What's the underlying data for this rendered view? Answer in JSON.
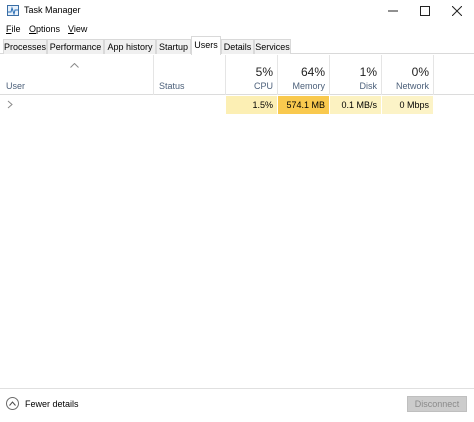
{
  "window": {
    "title": "Task Manager"
  },
  "menu": {
    "file": {
      "ul": "F",
      "rest": "ile"
    },
    "options": {
      "ul": "O",
      "rest": "ptions"
    },
    "view": {
      "ul": "V",
      "rest": "iew"
    }
  },
  "tabs": [
    "Processes",
    "Performance",
    "App history",
    "Startup",
    "Users",
    "Details",
    "Services"
  ],
  "active_tab": "Users",
  "columns": {
    "user": "User",
    "status": "Status",
    "cpu": {
      "pct": "5%",
      "label": "CPU"
    },
    "memory": {
      "pct": "64%",
      "label": "Memory"
    },
    "disk": {
      "pct": "1%",
      "label": "Disk"
    },
    "network": {
      "pct": "0%",
      "label": "Network"
    }
  },
  "rows": [
    {
      "cpu": "1.5%",
      "memory": "574.1 MB",
      "disk": "0.1 MB/s",
      "network": "0 Mbps"
    }
  ],
  "footer": {
    "fewer_details": "Fewer details",
    "disconnect": {
      "ul": "Disconnect"
    }
  },
  "colors": {
    "cpu_cell": "#fcefb4",
    "memory_cell": "#f9c94e",
    "disk_cell": "#fcf2c1",
    "network_cell": "#fcf3c7"
  },
  "icons": [
    "task-manager-icon",
    "minimize-icon",
    "maximize-icon",
    "close-icon",
    "sort-up-icon",
    "expand-chevron-icon",
    "chevron-up-icon"
  ]
}
